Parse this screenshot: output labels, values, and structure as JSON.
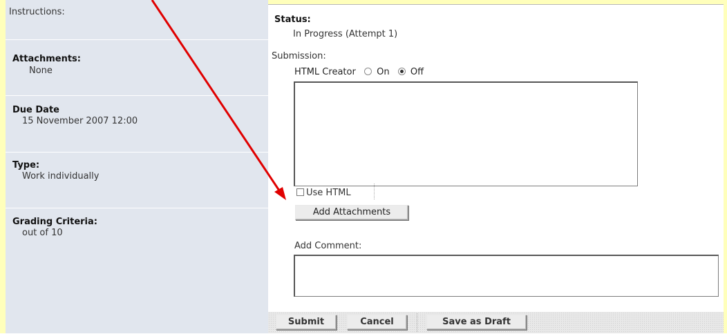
{
  "left": {
    "instructions_label": "Instructions:",
    "attachments_heading": "Attachments:",
    "attachments_value": "None",
    "due_heading": "Due Date",
    "due_value": "15 November 2007 12:00",
    "type_heading": "Type:",
    "type_value": "Work individually",
    "grading_heading": "Grading Criteria:",
    "grading_value": "out of 10"
  },
  "main": {
    "status_heading": "Status:",
    "status_value": "In Progress (Attempt 1)",
    "submission_label": "Submission:",
    "html_creator_label": "HTML Creator",
    "radio_on_label": "On",
    "radio_off_label": "Off",
    "html_creator_selected": "Off",
    "use_html_label": "Use HTML",
    "add_attachments_button": "Add Attachments",
    "add_comment_label": "Add Comment:"
  },
  "footer": {
    "submit_button": "Submit",
    "cancel_button": "Cancel",
    "save_draft_button": "Save as Draft"
  },
  "colors": {
    "annotation_arrow": "#e00000",
    "left_panel": "#e1e6ee",
    "page_edge": "#ffffbb"
  }
}
